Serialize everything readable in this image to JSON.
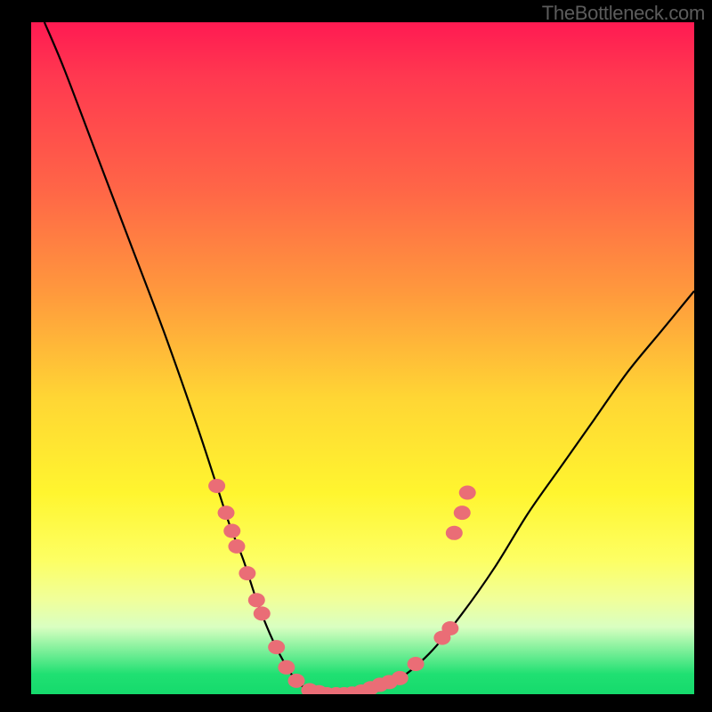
{
  "watermark": "TheBottleneck.com",
  "colors": {
    "gradient_top": "#ff1a52",
    "gradient_mid": "#fff52f",
    "gradient_bottom": "#15da6c",
    "curve": "#000000",
    "marker": "#ea6d76",
    "frame": "#000000"
  },
  "chart_data": {
    "type": "line",
    "title": "",
    "xlabel": "",
    "ylabel": "",
    "xlim": [
      0,
      100
    ],
    "ylim": [
      0,
      100
    ],
    "series": [
      {
        "name": "bottleneck-curve",
        "x": [
          2,
          5,
          10,
          15,
          20,
          25,
          28,
          30,
          32,
          34,
          36,
          38,
          40,
          42,
          44,
          47,
          50,
          55,
          60,
          65,
          70,
          75,
          80,
          85,
          90,
          95,
          100
        ],
        "y": [
          100,
          93,
          80,
          67,
          54,
          40,
          31,
          25,
          20,
          14,
          9,
          5,
          2,
          0.5,
          0,
          0,
          0.5,
          2,
          6,
          12,
          19,
          27,
          34,
          41,
          48,
          54,
          60
        ]
      }
    ],
    "markers": [
      {
        "x": 28.0,
        "y": 31.0
      },
      {
        "x": 29.4,
        "y": 27.0
      },
      {
        "x": 30.3,
        "y": 24.3
      },
      {
        "x": 31.0,
        "y": 22.0
      },
      {
        "x": 32.6,
        "y": 18.0
      },
      {
        "x": 34.0,
        "y": 14.0
      },
      {
        "x": 34.8,
        "y": 12.0
      },
      {
        "x": 37.0,
        "y": 7.0
      },
      {
        "x": 38.5,
        "y": 4.0
      },
      {
        "x": 40.0,
        "y": 2.0
      },
      {
        "x": 42.0,
        "y": 0.6
      },
      {
        "x": 43.4,
        "y": 0.3
      },
      {
        "x": 44.6,
        "y": 0.0
      },
      {
        "x": 46.0,
        "y": 0.0
      },
      {
        "x": 47.2,
        "y": 0.0
      },
      {
        "x": 48.4,
        "y": 0.1
      },
      {
        "x": 49.8,
        "y": 0.4
      },
      {
        "x": 51.2,
        "y": 0.9
      },
      {
        "x": 52.6,
        "y": 1.4
      },
      {
        "x": 54.0,
        "y": 1.8
      },
      {
        "x": 55.6,
        "y": 2.4
      },
      {
        "x": 58.0,
        "y": 4.5
      },
      {
        "x": 62.0,
        "y": 8.4
      },
      {
        "x": 63.2,
        "y": 9.8
      },
      {
        "x": 63.8,
        "y": 24.0
      },
      {
        "x": 65.0,
        "y": 27.0
      },
      {
        "x": 65.8,
        "y": 30.0
      }
    ]
  }
}
